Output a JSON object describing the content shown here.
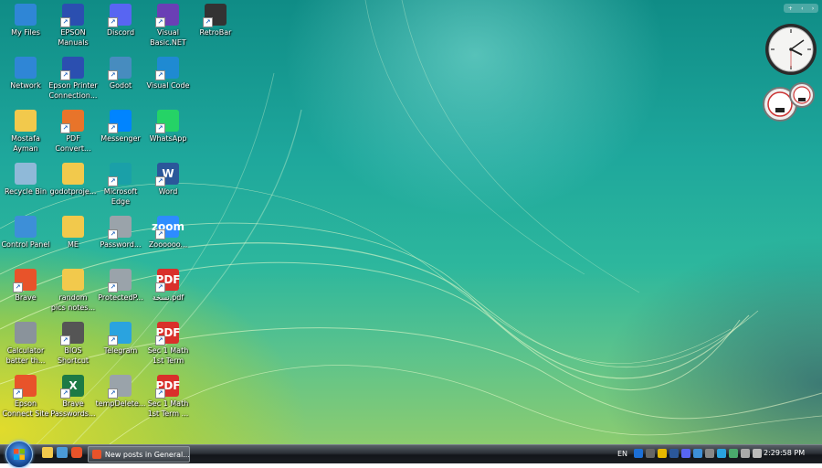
{
  "desktop": {
    "icons": [
      {
        "label": "My Files",
        "glyph": "",
        "color": "#2f86d6",
        "icon": "monitor-icon"
      },
      {
        "label": "EPSON\nManuals",
        "glyph": "",
        "color": "#2b4fb0",
        "icon": "epson-manuals-icon"
      },
      {
        "label": "Discord",
        "glyph": "",
        "color": "#5865f2",
        "icon": "discord-icon"
      },
      {
        "label": "Visual\nBasic.NET",
        "glyph": "",
        "color": "#6a3fb5",
        "icon": "visual-basic-icon"
      },
      {
        "label": "RetroBar",
        "glyph": "",
        "color": "#333",
        "icon": "retrobar-icon"
      },
      {
        "label": "Network",
        "glyph": "",
        "color": "#2f86d6",
        "icon": "network-icon"
      },
      {
        "label": "Epson Printer\nConnection...",
        "glyph": "",
        "color": "#2b4fb0",
        "icon": "epson-printer-icon"
      },
      {
        "label": "Godot",
        "glyph": "",
        "color": "#478cbf",
        "icon": "godot-icon"
      },
      {
        "label": "Visual Code",
        "glyph": "",
        "color": "#1f8ad2",
        "icon": "vscode-icon"
      },
      {
        "label": "Mostafa\nAyman",
        "glyph": "",
        "color": "#f2c94c",
        "icon": "folder-icon"
      },
      {
        "label": "PDF\nConvert...",
        "glyph": "",
        "color": "#e8742a",
        "icon": "pdf-converter-icon"
      },
      {
        "label": "Messenger",
        "glyph": "",
        "color": "#0084ff",
        "icon": "messenger-icon"
      },
      {
        "label": "WhatsApp",
        "glyph": "",
        "color": "#25d366",
        "icon": "whatsapp-icon"
      },
      {
        "label": "Recycle Bin",
        "glyph": "",
        "color": "#8fb9d8",
        "icon": "recycle-bin-icon"
      },
      {
        "label": "godotproje...",
        "glyph": "",
        "color": "#f2c94c",
        "icon": "folder-icon"
      },
      {
        "label": "Microsoft\nEdge",
        "glyph": "",
        "color": "#1aa0a8",
        "icon": "edge-icon"
      },
      {
        "label": "Word",
        "glyph": "W",
        "color": "#2b579a",
        "icon": "word-icon"
      },
      {
        "label": "Control Panel",
        "glyph": "",
        "color": "#3d8fd8",
        "icon": "control-panel-icon"
      },
      {
        "label": "ME",
        "glyph": "",
        "color": "#f2c94c",
        "icon": "folder-icon"
      },
      {
        "label": "Password...",
        "glyph": "",
        "color": "#9aa3aa",
        "icon": "settings-file-icon"
      },
      {
        "label": "Zoooooo...",
        "glyph": "zoom",
        "color": "#2d8cff",
        "icon": "zoom-icon"
      },
      {
        "label": "Brave",
        "glyph": "",
        "color": "#e8532a",
        "icon": "brave-icon"
      },
      {
        "label": "random\npics notes...",
        "glyph": "",
        "color": "#f2c94c",
        "icon": "folder-icon"
      },
      {
        "label": "ProtectedP...",
        "glyph": "",
        "color": "#9aa3aa",
        "icon": "settings-file-icon"
      },
      {
        "label": "نسخة.pdf",
        "glyph": "PDF",
        "color": "#d9302b",
        "icon": "pdf-icon"
      },
      {
        "label": "Calculator\nbatter th...",
        "glyph": "",
        "color": "#8a939b",
        "icon": "calculator-icon"
      },
      {
        "label": "BIOS\nShortcut",
        "glyph": "",
        "color": "#555",
        "icon": "bios-icon"
      },
      {
        "label": "Telegram",
        "glyph": "",
        "color": "#2aa3df",
        "icon": "telegram-icon"
      },
      {
        "label": "Sec 1 Math\n1st Term",
        "glyph": "PDF",
        "color": "#d9302b",
        "icon": "pdf-icon"
      },
      {
        "label": "Epson\nConnect Site",
        "glyph": "",
        "color": "#e8532a",
        "icon": "brave-icon"
      },
      {
        "label": "Brave\nPasswords...",
        "glyph": "X",
        "color": "#1d7a45",
        "icon": "excel-icon"
      },
      {
        "label": "tempDelete...",
        "glyph": "",
        "color": "#9aa3aa",
        "icon": "settings-file-icon"
      },
      {
        "label": "Sec 1 Math\n1st Term ...",
        "glyph": "PDF",
        "color": "#d9302b",
        "icon": "pdf-icon"
      }
    ]
  },
  "taskbar": {
    "task_label": "New posts in General...",
    "language": "EN",
    "clock": "2:29:58 PM"
  }
}
